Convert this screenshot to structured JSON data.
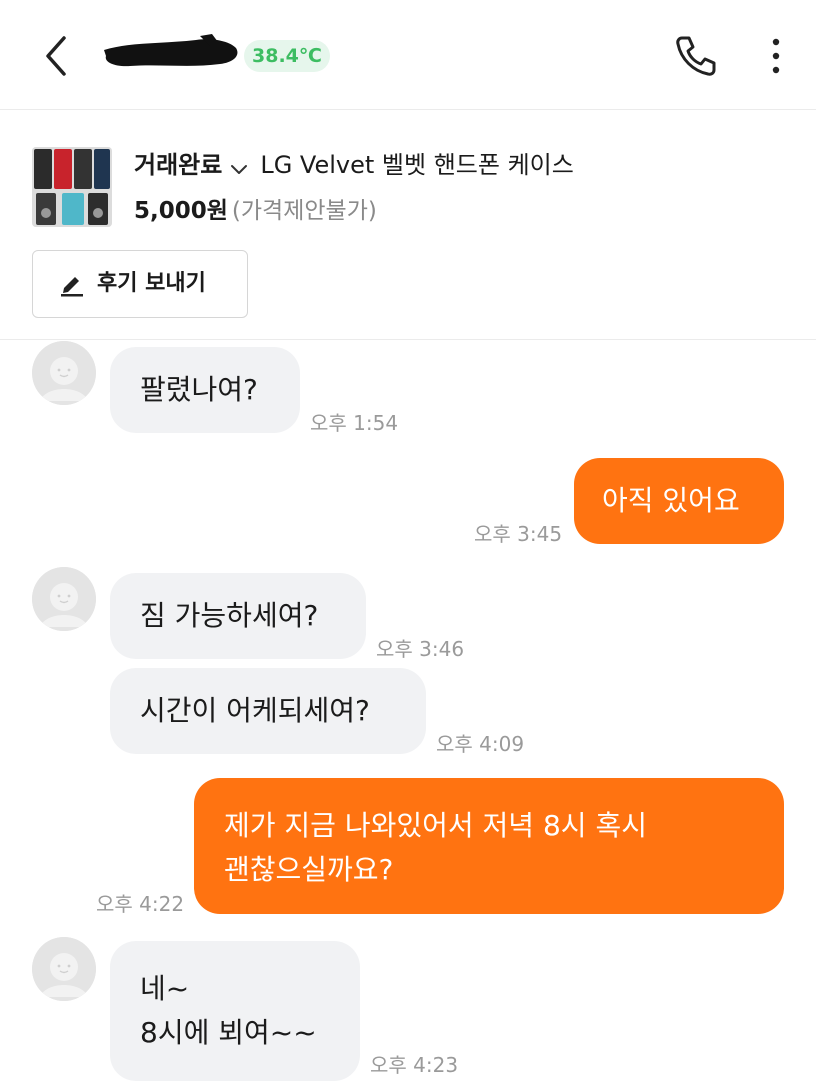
{
  "header": {
    "temperature": "38.4℃",
    "colors": {
      "temp_bg": "#e6f6ec",
      "temp_text": "#3dbd62"
    }
  },
  "product": {
    "status": "거래완료",
    "title": "LG Velvet 벨벳 핸드폰 케이스",
    "price": "5,000원",
    "price_note": "(가격제안불가)",
    "review_button": "후기 보내기"
  },
  "colors": {
    "accent": "#ff7311",
    "incoming_bubble": "#f1f2f4"
  },
  "messages": [
    {
      "direction": "incoming",
      "text": "팔렸나여?",
      "time": "오후 1:54"
    },
    {
      "direction": "outgoing",
      "text": "아직 있어요",
      "time": "오후 3:45"
    },
    {
      "direction": "incoming",
      "text": "짐 가능하세여?",
      "time": "오후 3:46"
    },
    {
      "direction": "incoming",
      "text": "시간이 어케되세여?",
      "time": "오후 4:09"
    },
    {
      "direction": "outgoing",
      "lines": [
        "제가 지금 나와있어서 저녁 8시 혹시",
        "괜찮으실까요?"
      ],
      "time": "오후 4:22"
    },
    {
      "direction": "incoming",
      "lines": [
        "네~",
        "8시에 뵈여~~"
      ],
      "time": "오후 4:23"
    }
  ]
}
